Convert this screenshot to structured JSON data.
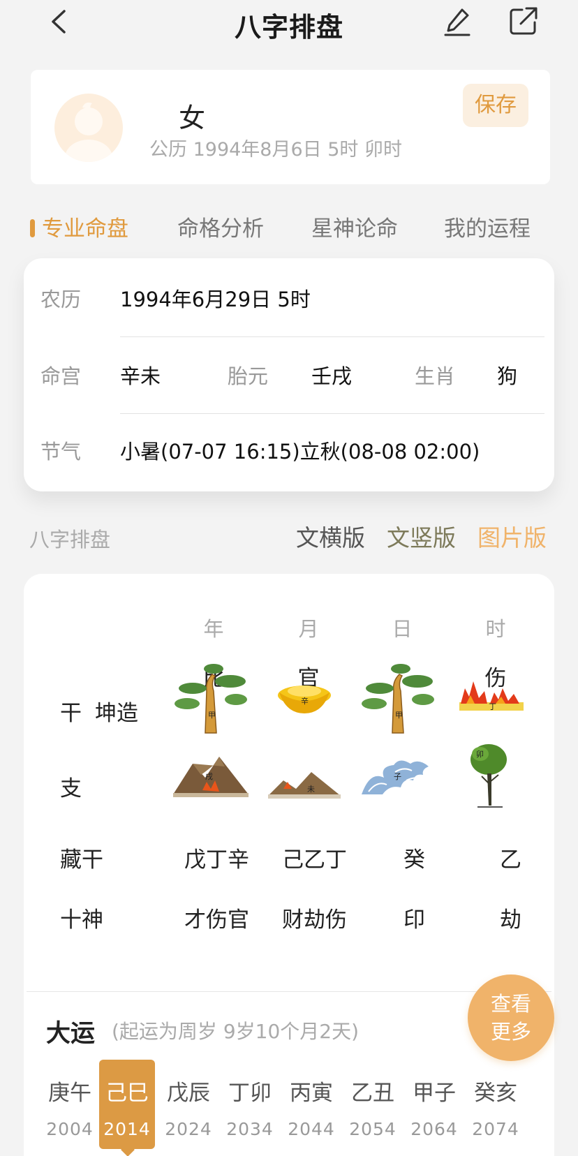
{
  "header": {
    "title": "八字排盘",
    "back_icon": "chevron-left-icon",
    "edit_icon": "pencil-icon",
    "share_icon": "share-external-icon"
  },
  "profile": {
    "gender": "女",
    "solar_date": "公历 1994年8月6日 5时 卯时",
    "save_label": "保存"
  },
  "tabs": [
    {
      "label": "专业命盘",
      "active": true
    },
    {
      "label": "命格分析",
      "active": false
    },
    {
      "label": "星神论命",
      "active": false
    },
    {
      "label": "我的运程",
      "active": false
    }
  ],
  "info": {
    "lunar_label": "农历",
    "lunar_value": "1994年6月29日 5时",
    "minggong_label": "命宫",
    "minggong_value": "辛未",
    "taiyuan_label": "胎元",
    "taiyuan_value": "壬戌",
    "zodiac_label": "生肖",
    "zodiac_value": "狗",
    "jieqi_label": "节气",
    "jieqi_value": "小暑(07-07 16:15)立秋(08-08 02:00)"
  },
  "section": {
    "title": "八字排盘",
    "versions": [
      {
        "label": "文横版",
        "color": "#555555"
      },
      {
        "label": "文竖版",
        "color": "#7d7a5a"
      },
      {
        "label": "图片版",
        "color": "#f0b36a"
      }
    ]
  },
  "chart": {
    "columns": [
      "年",
      "月",
      "日",
      "时"
    ],
    "ten_gods_top": [
      "比",
      "官",
      "",
      "伤"
    ],
    "row_labels": {
      "gan": "干",
      "kunzao": "坤造",
      "zhi": "支",
      "canggan": "藏干",
      "shishen": "十神"
    },
    "gan_images": [
      {
        "icon": "pine-tree-icon",
        "char": "甲"
      },
      {
        "icon": "gold-ingot-icon",
        "char": "辛"
      },
      {
        "icon": "pine-tree-icon",
        "char": "甲"
      },
      {
        "icon": "fire-icon",
        "char": "丁"
      }
    ],
    "zhi_images": [
      {
        "icon": "mountain-fire-icon",
        "char": "戌"
      },
      {
        "icon": "hills-fire-icon",
        "char": "未"
      },
      {
        "icon": "waves-icon",
        "char": "子"
      },
      {
        "icon": "small-tree-icon",
        "char": "卯"
      }
    ],
    "hidden_stems": [
      "戊丁辛",
      "己乙丁",
      "癸",
      "乙"
    ],
    "ten_gods_bottom": [
      "才伤官",
      "财劫伤",
      "印",
      "劫"
    ]
  },
  "dayun": {
    "title": "大运",
    "note": "(起运为周岁 9岁10个月2天)",
    "more_line1": "查看",
    "more_line2": "更多",
    "items": [
      {
        "gz": "庚午",
        "year": "2004",
        "selected": false
      },
      {
        "gz": "己巳",
        "year": "2014",
        "selected": true
      },
      {
        "gz": "戊辰",
        "year": "2024",
        "selected": false
      },
      {
        "gz": "丁卯",
        "year": "2034",
        "selected": false
      },
      {
        "gz": "丙寅",
        "year": "2044",
        "selected": false
      },
      {
        "gz": "乙丑",
        "year": "2054",
        "selected": false
      },
      {
        "gz": "甲子",
        "year": "2064",
        "selected": false
      },
      {
        "gz": "癸亥",
        "year": "2074",
        "selected": false
      }
    ]
  },
  "colors": {
    "accent": "#e09a3e",
    "selected_bg": "#dc9a44",
    "more_bg": "#f0b36a"
  }
}
